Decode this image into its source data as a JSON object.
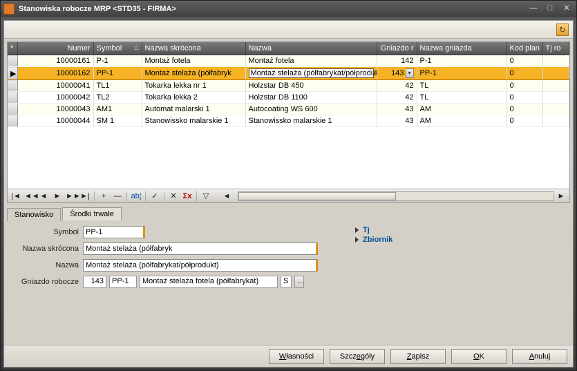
{
  "window": {
    "title": "Stanowiska robocze MRP <STD35 - FIRMA>"
  },
  "columns": {
    "numer": "Numer",
    "symbol": "Symbol",
    "nazwa_skr": "Nazwa skrócona",
    "nazwa": "Nazwa",
    "gniazdo": "Gniazdo r",
    "nazwa_gn": "Nazwa gniazda",
    "kod": "Kod plan",
    "tj": "Tj ro"
  },
  "rows": [
    {
      "numer": "10000161",
      "symbol": "P-1",
      "nazwa_skr": "Montaż fotela",
      "nazwa": "Montaż fotela",
      "gniazdo": "142",
      "nazwa_gn": "P-1",
      "kod": "0"
    },
    {
      "numer": "10000162",
      "symbol": "PP-1",
      "nazwa_skr": "Montaż stelaża (półfabryk",
      "nazwa": "Montaż stelaża (półfabrykat/półprodukt)",
      "gniazdo": "143",
      "nazwa_gn": "PP-1",
      "kod": "0"
    },
    {
      "numer": "10000041",
      "symbol": "TL1",
      "nazwa_skr": "Tokarka lekka nr 1",
      "nazwa": "Holzstar DB 450",
      "gniazdo": "42",
      "nazwa_gn": "TL",
      "kod": "0"
    },
    {
      "numer": "10000042",
      "symbol": "TL2",
      "nazwa_skr": "Tokarka lekka 2",
      "nazwa": "Holzstar DB 1100",
      "gniazdo": "42",
      "nazwa_gn": "TL",
      "kod": "0"
    },
    {
      "numer": "10000043",
      "symbol": "AM1",
      "nazwa_skr": "Automat malarski 1",
      "nazwa": "Autocoating WS 600",
      "gniazdo": "43",
      "nazwa_gn": "AM",
      "kod": "0"
    },
    {
      "numer": "10000044",
      "symbol": "SM 1",
      "nazwa_skr": "Stanowissko malarskie 1",
      "nazwa": "Stanowissko malarskie 1",
      "gniazdo": "43",
      "nazwa_gn": "AM",
      "kod": "0"
    }
  ],
  "selected_index": 1,
  "tabs": {
    "stanowisko": "Stanowisko",
    "srodki": "Środki trwałe"
  },
  "form": {
    "symbol_label": "Symbol",
    "symbol_value": "PP-1",
    "nazwa_skr_label": "Nazwa skrócona",
    "nazwa_skr_value": "Montaż stelaża (półfabryk",
    "nazwa_label": "Nazwa",
    "nazwa_value": "Montaż stelaża (półfabrykat/półprodukt)",
    "gniazdo_label": "Gniazdo robocze",
    "gniazdo_num": "143",
    "gniazdo_sym": "PP-1",
    "gniazdo_desc": "Montaż stelaża fotela (półfabrykat)",
    "gniazdo_s": "S"
  },
  "tree": {
    "tj": "Tj",
    "zbiornik": "Zbiornik"
  },
  "buttons": {
    "wlasnosci": "Własności",
    "szczegoly": "Szczegóły",
    "zapisz": "Zapisz",
    "ok": "OK",
    "anuluj": "Anuluj"
  },
  "sort_indicator": "△"
}
